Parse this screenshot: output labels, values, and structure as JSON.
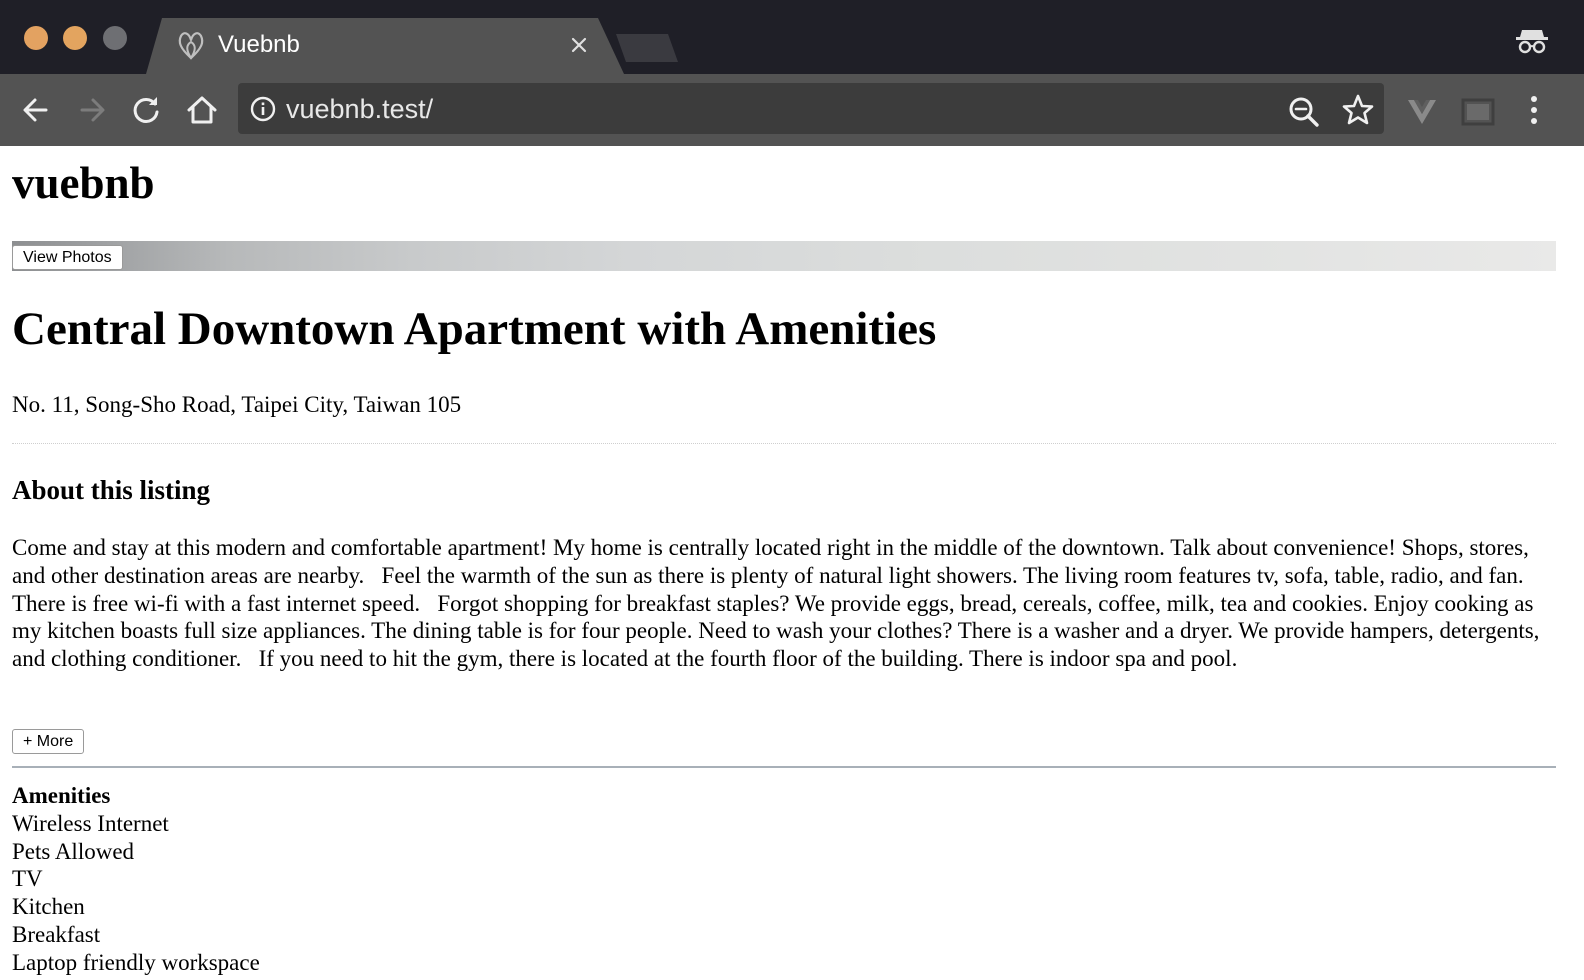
{
  "browser": {
    "tab_title": "Vuebnb",
    "url": "vuebnb.test/"
  },
  "page": {
    "site_title": "vuebnb",
    "view_photos_label": "View Photos",
    "listing_title": "Central Downtown Apartment with Amenities",
    "address": "No. 11, Song-Sho Road, Taipei City, Taiwan 105",
    "about_heading": "About this listing",
    "about_text": "Come and stay at this modern and comfortable apartment! My home is centrally located right in the middle of the downtown. Talk about convenience! Shops, stores, and other destination areas are nearby.   Feel the warmth of the sun as there is plenty of natural light showers. The living room features tv, sofa, table, radio, and fan. There is free wi-fi with a fast internet speed.   Forgot shopping for breakfast staples? We provide eggs, bread, cereals, coffee, milk, tea and cookies. Enjoy cooking as my kitchen boasts full size appliances. The dining table is for four people. Need to wash your clothes? There is a washer and a dryer. We provide hampers, detergents, and clothing conditioner.   If you need to hit the gym, there is located at the fourth floor of the building. There is indoor spa and pool.",
    "more_label": "+ More",
    "amenities_heading": "Amenities",
    "amenities": [
      "Wireless Internet",
      "Pets Allowed",
      "TV",
      "Kitchen",
      "Breakfast",
      "Laptop friendly workspace"
    ]
  },
  "icons": {
    "tab_favicon": "airbnb-logo-icon",
    "tab_close": "close-icon",
    "back": "arrow-left-icon",
    "forward": "arrow-right-icon",
    "reload": "reload-icon",
    "home": "home-icon",
    "site_info": "info-icon",
    "zoom": "zoom-out-icon",
    "bookmark": "star-icon",
    "extension_vue": "vue-devtools-icon",
    "extension_cast": "cast-icon",
    "menu": "kebab-menu-icon",
    "incognito": "incognito-icon"
  },
  "colors": {
    "titlebar": "#1f1f27",
    "toolbar": "#535353",
    "omnibox": "#3c3c3c",
    "traffic_close": "#e3a261",
    "traffic_min": "#e3a45f",
    "traffic_max": "#6e6f73"
  }
}
